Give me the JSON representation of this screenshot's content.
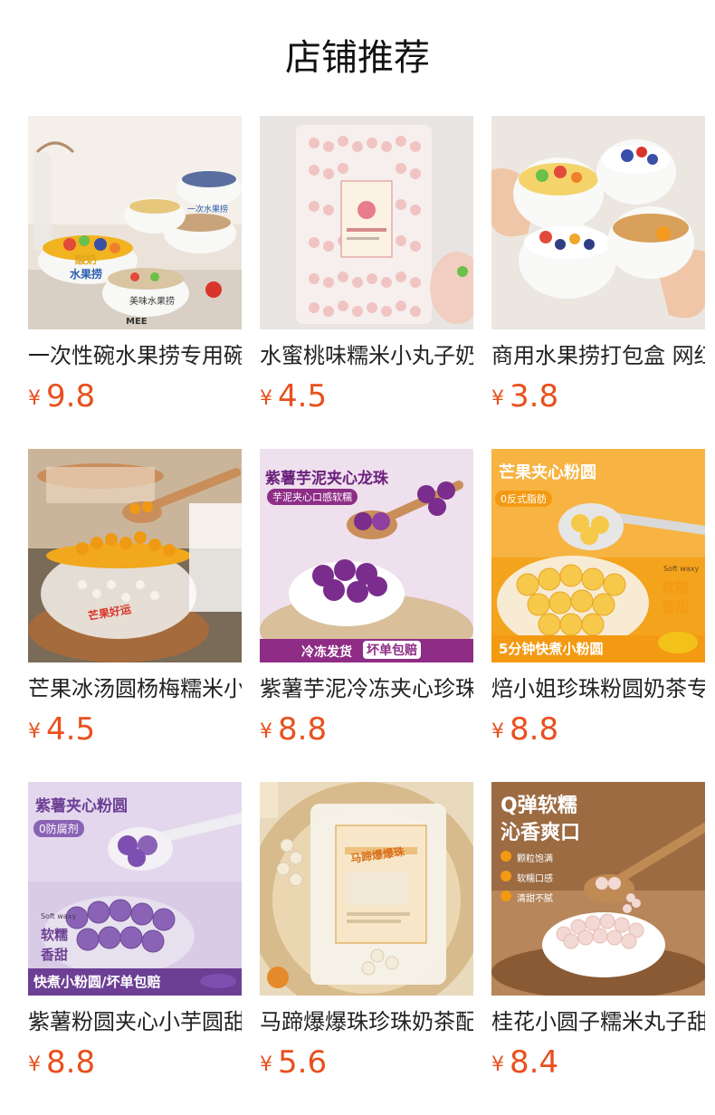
{
  "page": {
    "title": "店铺推荐"
  },
  "products": [
    {
      "name": "一次性碗水果捞专用碗",
      "currency": "¥",
      "price": "9.8",
      "image_texts": [
        "酸奶",
        "水果捞",
        "美味水果捞",
        "一次水果捞",
        "MEE"
      ]
    },
    {
      "name": "水蜜桃味糯米小丸子奶茶",
      "currency": "¥",
      "price": "4.5",
      "image_texts": []
    },
    {
      "name": "商用水果捞打包盒 网红",
      "currency": "¥",
      "price": "3.8",
      "image_texts": []
    },
    {
      "name": "芒果冰汤圆杨梅糯米小丸子",
      "currency": "¥",
      "price": "4.5",
      "image_texts": [
        "芒果好运"
      ]
    },
    {
      "name": "紫薯芋泥冷冻夹心珍珠",
      "currency": "¥",
      "price": "8.8",
      "image_texts": [
        "紫薯芋泥夹心龙珠",
        "芋泥夹心口感软糯",
        "冷冻发货",
        "坏单包赔"
      ]
    },
    {
      "name": "焙小姐珍珠粉圆奶茶专用",
      "currency": "¥",
      "price": "8.8",
      "image_texts": [
        "芒果夹心粉圆",
        "0反式脂肪",
        "软糯",
        "香甜",
        "5分钟快煮小粉圆",
        "Soft waxy"
      ]
    },
    {
      "name": "紫薯粉圆夹心小芋圆甜品",
      "currency": "¥",
      "price": "8.8",
      "image_texts": [
        "紫薯夹心粉圆",
        "0防腐剂",
        "软糯",
        "香甜",
        "快煮小粉圆/坏单包赔",
        "Soft waxy"
      ]
    },
    {
      "name": "马蹄爆爆珠珍珠奶茶配料",
      "currency": "¥",
      "price": "5.6",
      "image_texts": [
        "马蹄爆爆珠"
      ]
    },
    {
      "name": "桂花小圆子糯米丸子甜品",
      "currency": "¥",
      "price": "8.4",
      "image_texts": [
        "Q弹软糯",
        "沁香爽口",
        "颗粒饱满",
        "软糯口感",
        "清甜不腻"
      ]
    }
  ]
}
